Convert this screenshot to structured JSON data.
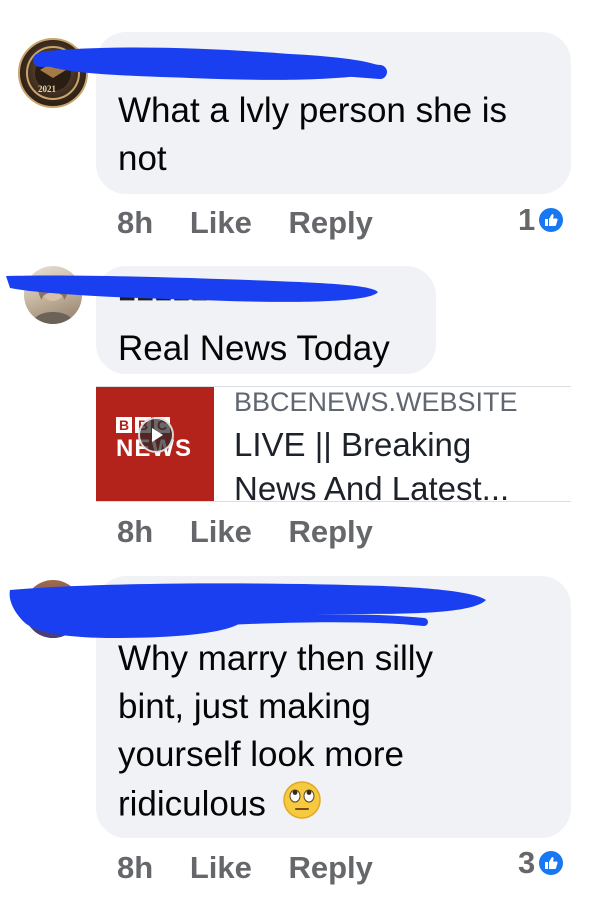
{
  "comments": [
    {
      "text_line1": "What a lvly person she is",
      "text_line2": "not",
      "time": "8h",
      "like_label": "Like",
      "reply_label": "Reply",
      "reaction_count": "1"
    },
    {
      "text_line1": "Real News Today",
      "time": "8h",
      "like_label": "Like",
      "reply_label": "Reply",
      "link": {
        "domain": "BBCENEWS.WEBSITE",
        "title_line1": "LIVE || Breaking",
        "title_line2": "News And Latest...",
        "thumb_letters": [
          "B",
          "B",
          "C"
        ],
        "thumb_word": "NEWS"
      }
    },
    {
      "text_line1": "Why marry then silly",
      "text_line2": "bint, just making",
      "text_line3": "yourself look more",
      "text_line4": "ridiculous",
      "time": "8h",
      "like_label": "Like",
      "reply_label": "Reply",
      "reaction_count": "3"
    }
  ],
  "avatar1_text": "2021",
  "colors": {
    "bubble": "#f0f2f5",
    "scribble": "#1a3ff0",
    "like_blue": "#1877f2",
    "meta_gray": "#65676b",
    "bbc_red": "#b3221b"
  },
  "icons": [
    "like-icon",
    "eye-roll-emoji",
    "play-icon"
  ]
}
